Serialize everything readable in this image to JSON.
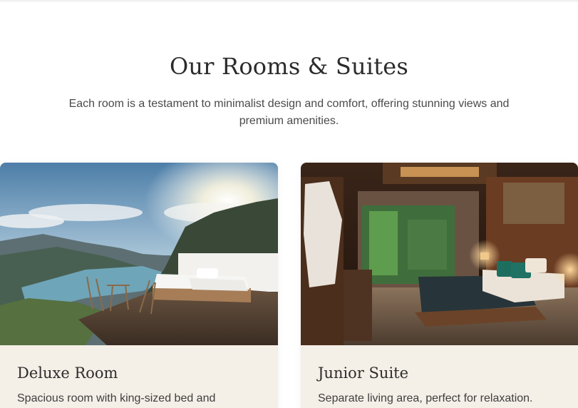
{
  "section": {
    "title": "Our Rooms & Suites",
    "subtitle": "Each room is a testament to minimalist design and comfort, offering stunning views and premium amenities."
  },
  "rooms": [
    {
      "name": "Deluxe Room",
      "description": "Spacious room with king-sized bed and",
      "image": "outdoor-bed-mountain-lake-photo"
    },
    {
      "name": "Junior Suite",
      "description": "Separate living area, perfect for relaxation.",
      "image": "warm-wood-bedroom-garden-photo"
    }
  ]
}
